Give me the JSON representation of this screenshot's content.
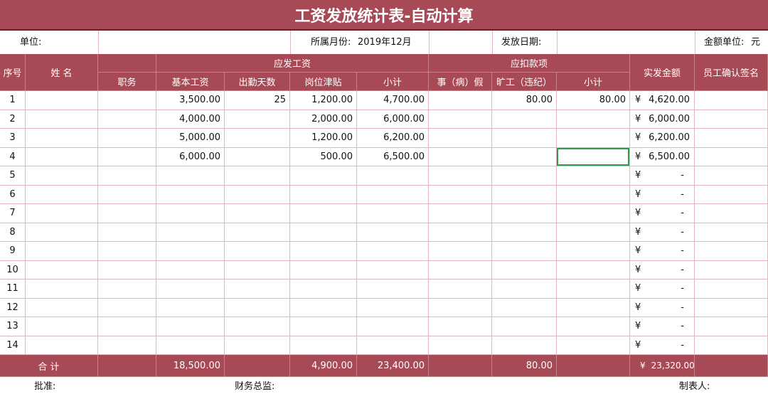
{
  "title": "工资发放统计表-自动计算",
  "info": {
    "unit_label": "单位:",
    "month_label": "所属月份:",
    "month_value": "2019年12月",
    "date_label": "发放日期:",
    "currency_label": "金额单位:",
    "currency_value": "元"
  },
  "headers": {
    "seq": "序号",
    "name": "姓  名",
    "gross_group": "应发工资",
    "position": "职务",
    "base": "基本工资",
    "days": "出勤天数",
    "allowance": "岗位津贴",
    "gross_subtotal": "小计",
    "deduct_group": "应扣款项",
    "leave": "事（病）假",
    "absence": "旷工（违纪）",
    "deduct_subtotal": "小计",
    "net": "实发金额",
    "signature": "员工确认签名"
  },
  "currency_symbol": "¥",
  "rows": [
    {
      "seq": "1",
      "name": "",
      "position": "",
      "base": "3,500.00",
      "days": "25",
      "allowance": "1,200.00",
      "gross": "4,700.00",
      "leave": "",
      "absence": "80.00",
      "deduct": "80.00",
      "net": "4,620.00",
      "sign": ""
    },
    {
      "seq": "2",
      "name": "",
      "position": "",
      "base": "4,000.00",
      "days": "",
      "allowance": "2,000.00",
      "gross": "6,000.00",
      "leave": "",
      "absence": "",
      "deduct": "",
      "net": "6,000.00",
      "sign": ""
    },
    {
      "seq": "3",
      "name": "",
      "position": "",
      "base": "5,000.00",
      "days": "",
      "allowance": "1,200.00",
      "gross": "6,200.00",
      "leave": "",
      "absence": "",
      "deduct": "",
      "net": "6,200.00",
      "sign": ""
    },
    {
      "seq": "4",
      "name": "",
      "position": "",
      "base": "6,000.00",
      "days": "",
      "allowance": "500.00",
      "gross": "6,500.00",
      "leave": "",
      "absence": "",
      "deduct": "",
      "net": "6,500.00",
      "sign": ""
    },
    {
      "seq": "5",
      "name": "",
      "position": "",
      "base": "",
      "days": "",
      "allowance": "",
      "gross": "",
      "leave": "",
      "absence": "",
      "deduct": "",
      "net": "-",
      "sign": ""
    },
    {
      "seq": "6",
      "name": "",
      "position": "",
      "base": "",
      "days": "",
      "allowance": "",
      "gross": "",
      "leave": "",
      "absence": "",
      "deduct": "",
      "net": "-",
      "sign": ""
    },
    {
      "seq": "7",
      "name": "",
      "position": "",
      "base": "",
      "days": "",
      "allowance": "",
      "gross": "",
      "leave": "",
      "absence": "",
      "deduct": "",
      "net": "-",
      "sign": ""
    },
    {
      "seq": "8",
      "name": "",
      "position": "",
      "base": "",
      "days": "",
      "allowance": "",
      "gross": "",
      "leave": "",
      "absence": "",
      "deduct": "",
      "net": "-",
      "sign": ""
    },
    {
      "seq": "9",
      "name": "",
      "position": "",
      "base": "",
      "days": "",
      "allowance": "",
      "gross": "",
      "leave": "",
      "absence": "",
      "deduct": "",
      "net": "-",
      "sign": ""
    },
    {
      "seq": "10",
      "name": "",
      "position": "",
      "base": "",
      "days": "",
      "allowance": "",
      "gross": "",
      "leave": "",
      "absence": "",
      "deduct": "",
      "net": "-",
      "sign": ""
    },
    {
      "seq": "11",
      "name": "",
      "position": "",
      "base": "",
      "days": "",
      "allowance": "",
      "gross": "",
      "leave": "",
      "absence": "",
      "deduct": "",
      "net": "-",
      "sign": ""
    },
    {
      "seq": "12",
      "name": "",
      "position": "",
      "base": "",
      "days": "",
      "allowance": "",
      "gross": "",
      "leave": "",
      "absence": "",
      "deduct": "",
      "net": "-",
      "sign": ""
    },
    {
      "seq": "13",
      "name": "",
      "position": "",
      "base": "",
      "days": "",
      "allowance": "",
      "gross": "",
      "leave": "",
      "absence": "",
      "deduct": "",
      "net": "-",
      "sign": ""
    },
    {
      "seq": "14",
      "name": "",
      "position": "",
      "base": "",
      "days": "",
      "allowance": "",
      "gross": "",
      "leave": "",
      "absence": "",
      "deduct": "",
      "net": "-",
      "sign": ""
    }
  ],
  "totals": {
    "label": "合    计",
    "base": "18,500.00",
    "allowance": "4,900.00",
    "gross": "23,400.00",
    "absence": "80.00",
    "net": "23,320.00"
  },
  "footer": {
    "approve_label": "批准:",
    "finance_label": "财务总监:",
    "preparer_label": "制表人:"
  },
  "colors": {
    "header_bg": "#a84956",
    "grid_line": "#e6b6bf",
    "selection": "#2f9a47"
  }
}
